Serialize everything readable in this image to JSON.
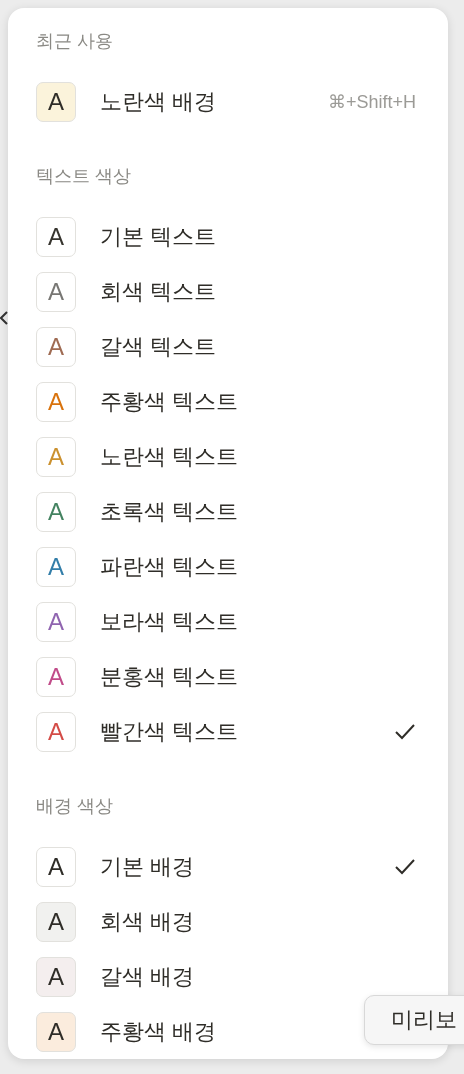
{
  "sections": [
    {
      "title": "최근 사용",
      "items": [
        {
          "kind": "background",
          "letter": "A",
          "label": "노란색 배경",
          "color": "#fbf3db",
          "shortcut": "⌘+Shift+H",
          "checked": false
        }
      ]
    },
    {
      "title": "텍스트 색상",
      "items": [
        {
          "kind": "text",
          "letter": "A",
          "label": "기본 텍스트",
          "color": "#37352f",
          "checked": false
        },
        {
          "kind": "text",
          "letter": "A",
          "label": "회색 텍스트",
          "color": "#787774",
          "checked": false
        },
        {
          "kind": "text",
          "letter": "A",
          "label": "갈색 텍스트",
          "color": "#9f6b53",
          "checked": false
        },
        {
          "kind": "text",
          "letter": "A",
          "label": "주황색 텍스트",
          "color": "#d9730d",
          "checked": false
        },
        {
          "kind": "text",
          "letter": "A",
          "label": "노란색 텍스트",
          "color": "#cb912f",
          "checked": false
        },
        {
          "kind": "text",
          "letter": "A",
          "label": "초록색 텍스트",
          "color": "#448361",
          "checked": false
        },
        {
          "kind": "text",
          "letter": "A",
          "label": "파란색 텍스트",
          "color": "#337ea9",
          "checked": false
        },
        {
          "kind": "text",
          "letter": "A",
          "label": "보라색 텍스트",
          "color": "#9065b0",
          "checked": false
        },
        {
          "kind": "text",
          "letter": "A",
          "label": "분홍색 텍스트",
          "color": "#c14c8a",
          "checked": false
        },
        {
          "kind": "text",
          "letter": "A",
          "label": "빨간색 텍스트",
          "color": "#d44c47",
          "checked": true
        }
      ]
    },
    {
      "title": "배경 색상",
      "items": [
        {
          "kind": "background",
          "letter": "A",
          "label": "기본 배경",
          "color": "#ffffff",
          "checked": true
        },
        {
          "kind": "background",
          "letter": "A",
          "label": "회색 배경",
          "color": "#f1f1ef",
          "checked": false
        },
        {
          "kind": "background",
          "letter": "A",
          "label": "갈색 배경",
          "color": "#f4eeee",
          "checked": false
        },
        {
          "kind": "background",
          "letter": "A",
          "label": "주황색 배경",
          "color": "#fbecdd",
          "checked": false
        }
      ]
    }
  ],
  "tooltip": {
    "text": "미리보"
  }
}
